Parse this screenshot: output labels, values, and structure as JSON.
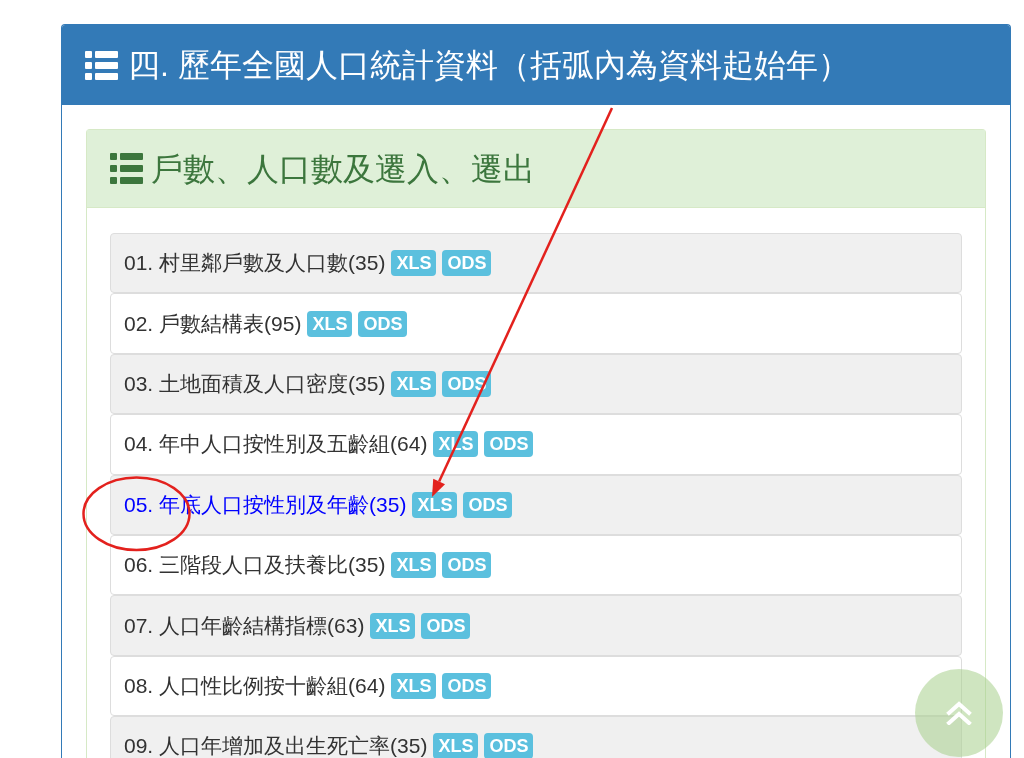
{
  "header": {
    "title": "四. 歷年全國人口統計資料（括弧內為資料起始年）"
  },
  "section": {
    "title": "戶數、人口數及遷入、遷出",
    "items": [
      {
        "label": "01. 村里鄰戶數及人口數(35)",
        "highlighted": false,
        "badges": [
          "XLS",
          "ODS"
        ]
      },
      {
        "label": "02. 戶數結構表(95)",
        "highlighted": false,
        "badges": [
          "XLS",
          "ODS"
        ]
      },
      {
        "label": "03. 土地面積及人口密度(35)",
        "highlighted": false,
        "badges": [
          "XLS",
          "ODS"
        ]
      },
      {
        "label": "04. 年中人口按性別及五齡組(64)",
        "highlighted": false,
        "badges": [
          "XLS",
          "ODS"
        ]
      },
      {
        "label": "05. 年底人口按性別及年齡(35)",
        "highlighted": true,
        "badges": [
          "XLS",
          "ODS"
        ]
      },
      {
        "label": "06. 三階段人口及扶養比(35)",
        "highlighted": false,
        "badges": [
          "XLS",
          "ODS"
        ]
      },
      {
        "label": "07. 人口年齡結構指標(63)",
        "highlighted": false,
        "badges": [
          "XLS",
          "ODS"
        ]
      },
      {
        "label": "08. 人口性比例按十齡組(64)",
        "highlighted": false,
        "badges": [
          "XLS",
          "ODS"
        ]
      },
      {
        "label": "09. 人口年增加及出生死亡率(35)",
        "highlighted": false,
        "badges": [
          "XLS",
          "ODS"
        ]
      }
    ]
  },
  "annotations": [
    {
      "kind": "arrow"
    },
    {
      "kind": "circle"
    }
  ]
}
